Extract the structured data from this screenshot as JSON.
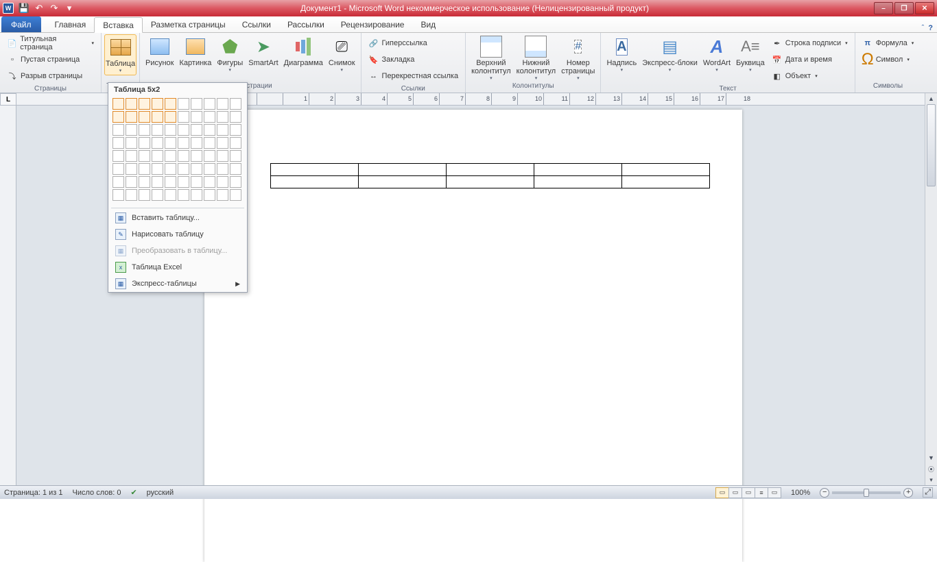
{
  "title": "Документ1 - Microsoft Word некоммерческое использование (Нелицензированный продукт)",
  "qat": {
    "save": "💾",
    "undo": "↶",
    "redo": "↷"
  },
  "tabs": {
    "file": "Файл",
    "items": [
      "Главная",
      "Вставка",
      "Разметка страницы",
      "Ссылки",
      "Рассылки",
      "Рецензирование",
      "Вид"
    ],
    "active_index": 1
  },
  "ribbon": {
    "pages": {
      "label": "Страницы",
      "cover": "Титульная страница",
      "blank": "Пустая страница",
      "break": "Разрыв страницы"
    },
    "tables": {
      "label": "Таблицы",
      "btn": "Таблица"
    },
    "illus": {
      "label": "Иллюстрации",
      "picture": "Рисунок",
      "clipart": "Картинка",
      "shapes": "Фигуры",
      "smartart": "SmartArt",
      "chart": "Диаграмма",
      "screenshot": "Снимок"
    },
    "links": {
      "label": "Ссылки",
      "hyper": "Гиперссылка",
      "bookmark": "Закладка",
      "crossref": "Перекрестная ссылка"
    },
    "headfoot": {
      "label": "Колонтитулы",
      "header": "Верхний\nколонтитул",
      "footer": "Нижний\nколонтитул",
      "pagenum": "Номер\nстраницы"
    },
    "text": {
      "label": "Текст",
      "textbox": "Надпись",
      "quickparts": "Экспресс-блоки",
      "wordart": "WordArt",
      "dropcap": "Буквица",
      "sigline": "Строка подписи",
      "datetime": "Дата и время",
      "object": "Объект"
    },
    "symbols": {
      "label": "Символы",
      "equation": "Формула",
      "symbol": "Символ"
    }
  },
  "table_dropdown": {
    "title": "Таблица 5x2",
    "sel_cols": 5,
    "sel_rows": 2,
    "grid_cols": 10,
    "grid_rows": 8,
    "insert": "Вставить таблицу...",
    "draw": "Нарисовать таблицу",
    "convert": "Преобразовать в таблицу...",
    "excel": "Таблица Excel",
    "quick": "Экспресс-таблицы"
  },
  "doc_table": {
    "rows": 2,
    "cols": 5
  },
  "ruler_max": 17,
  "status": {
    "page": "Страница: 1 из 1",
    "words": "Число слов: 0",
    "lang": "русский",
    "zoom": "100%"
  }
}
